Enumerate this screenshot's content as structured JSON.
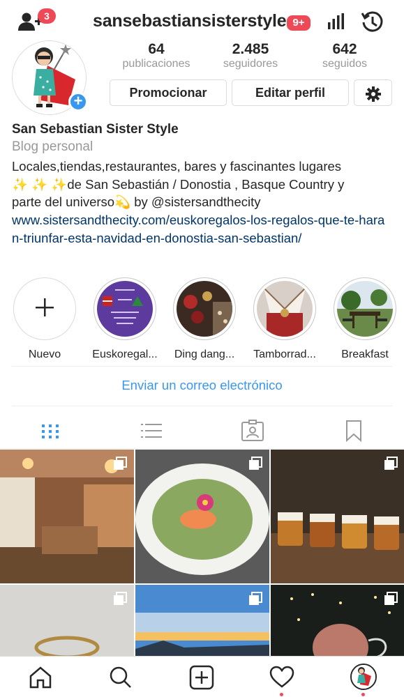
{
  "header": {
    "username": "sansebastiansisterstyle",
    "follow_requests_count": "3",
    "activity_badge": "9+",
    "icons": [
      "add-user-icon",
      "insights-icon",
      "archive-history-icon"
    ]
  },
  "profile": {
    "stats": [
      {
        "value": "64",
        "label": "publicaciones"
      },
      {
        "value": "2.485",
        "label": "seguidores"
      },
      {
        "value": "642",
        "label": "seguidos"
      }
    ],
    "buttons": {
      "promote": "Promocionar",
      "edit_profile": "Editar perfil"
    },
    "name": "San Sebastian Sister Style",
    "category": "Blog personal",
    "bio_line1": "Locales,tiendas,restaurantes, bares y fascinantes lugares",
    "bio_line2": "✨ ✨ ✨de San Sebastián / Donostia , Basque Country y",
    "bio_line3": "parte del universo💫 by @sistersandthecity",
    "link": "www.sistersandthecity.com/euskoregalos-los-regalos-que-te-haran-triunfar-esta-navidad-en-donostia-san-sebastian/"
  },
  "highlights": [
    {
      "label": "Nuevo"
    },
    {
      "label": "Euskoregal..."
    },
    {
      "label": "Ding dang..."
    },
    {
      "label": "Tamborrad..."
    },
    {
      "label": "Breakfast"
    }
  ],
  "email_button": "Enviar un correo electrónico",
  "tabs": [
    "grid-icon",
    "list-icon",
    "tagged-icon",
    "saved-icon"
  ],
  "bottom_nav": [
    "home-icon",
    "search-icon",
    "new-post-icon",
    "activity-heart-icon",
    "profile-avatar-icon"
  ],
  "colors": {
    "accent": "#3897f0",
    "badge": "#ed4956",
    "link": "#003569",
    "muted": "#999999"
  }
}
